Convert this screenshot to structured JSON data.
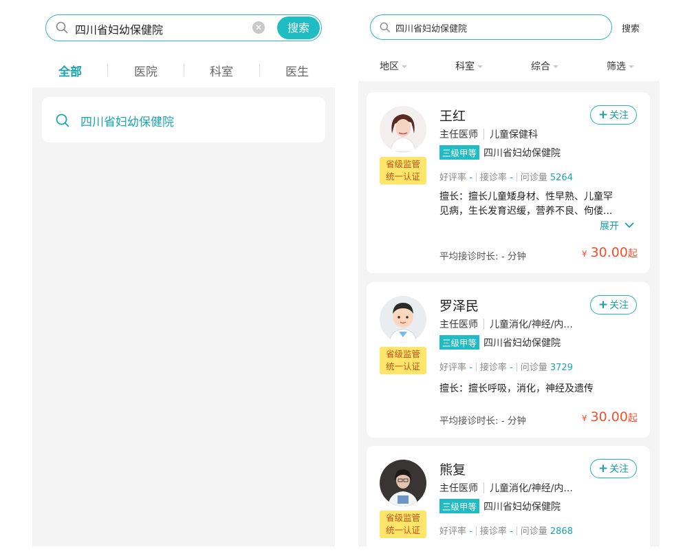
{
  "left": {
    "search": {
      "value": "四川省妇幼保健院",
      "button": "搜索"
    },
    "tabs": [
      "全部",
      "医院",
      "科室",
      "医生"
    ],
    "active_tab": 0,
    "suggestion": "四川省妇幼保健院"
  },
  "right": {
    "search": {
      "value": "四川省妇幼保健院",
      "button": "搜索"
    },
    "filters": [
      "地区",
      "科室",
      "综合",
      "筛选"
    ],
    "doctors": [
      {
        "name": "王红",
        "title": "主任医师",
        "dept": "儿童保健科",
        "level": "三级甲等",
        "hospital": "四川省妇幼保健院",
        "badge_line1": "省级监管",
        "badge_line2": "统一认证",
        "follow": "关注",
        "rating_label": "好评率",
        "rating": "-",
        "accept_label": "接诊率",
        "accept": "-",
        "consult_label": "问诊量",
        "consult": "5264",
        "specialty_line1": "擅长：擅长儿童矮身材、性早熟、儿童罕",
        "specialty_line2": "见病，生长发育迟缓，营养不良、佝偻...",
        "expand": "展开",
        "avg_label": "平均接诊时长:",
        "avg_value": "- 分钟",
        "price_symbol": "¥",
        "price": "30.00",
        "price_suffix": "起"
      },
      {
        "name": "罗泽民",
        "title": "主任医师",
        "dept": "儿童消化/神经/内...",
        "level": "三级甲等",
        "hospital": "四川省妇幼保健院",
        "badge_line1": "省级监管",
        "badge_line2": "统一认证",
        "follow": "关注",
        "rating_label": "好评率",
        "rating": "-",
        "accept_label": "接诊率",
        "accept": "-",
        "consult_label": "问诊量",
        "consult": "3729",
        "specialty_line1": "擅长：擅长呼吸，消化，神经及遗传",
        "avg_label": "平均接诊时长:",
        "avg_value": "- 分钟",
        "price_symbol": "¥",
        "price": "30.00",
        "price_suffix": "起"
      },
      {
        "name": "熊复",
        "title": "主任医师",
        "dept": "儿童消化/神经/内...",
        "level": "三级甲等",
        "hospital": "四川省妇幼保健院",
        "badge_line1": "省级监管",
        "badge_line2": "统一认证",
        "follow": "关注",
        "rating_label": "好评率",
        "rating": "-",
        "accept_label": "接诊率",
        "accept": "-",
        "consult_label": "问诊量",
        "consult": "2868"
      }
    ]
  },
  "colors": {
    "accent": "#1fbcc4",
    "price": "#f0502c",
    "badge": "#ffe66b",
    "panel_bg": "#f4f4f4"
  }
}
